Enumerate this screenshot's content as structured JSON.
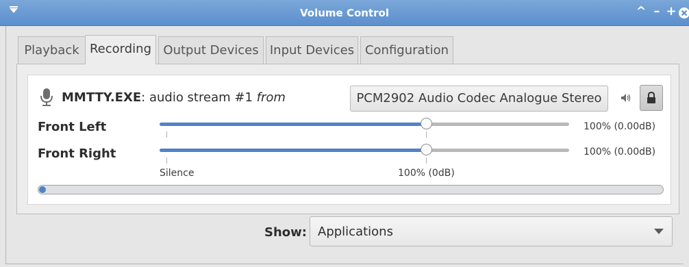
{
  "window": {
    "title": "Volume Control",
    "accent": "#5b8fcd"
  },
  "tabs": [
    {
      "label": "Playback",
      "active": false
    },
    {
      "label": "Recording",
      "active": true
    },
    {
      "label": "Output Devices",
      "active": false
    },
    {
      "label": "Input Devices",
      "active": false
    },
    {
      "label": "Configuration",
      "active": false
    }
  ],
  "stream": {
    "icon": "microphone-icon",
    "app_name": "MMTTY.EXE",
    "separator": ":",
    "description": " audio stream #1 ",
    "from": "from",
    "device": "PCM2902 Audio Codec Analogue Stereo",
    "channels": [
      {
        "label": "Front Left",
        "volume_text": "100% (0.00dB)",
        "level_percent": 100
      },
      {
        "label": "Front Right",
        "volume_text": "100% (0.00dB)",
        "level_percent": 100
      }
    ],
    "scale": {
      "silence": "Silence",
      "unity": "100% (0dB)"
    },
    "peak_level_percent": 1
  },
  "footer": {
    "show_label": "Show:",
    "show_value": "Applications"
  }
}
